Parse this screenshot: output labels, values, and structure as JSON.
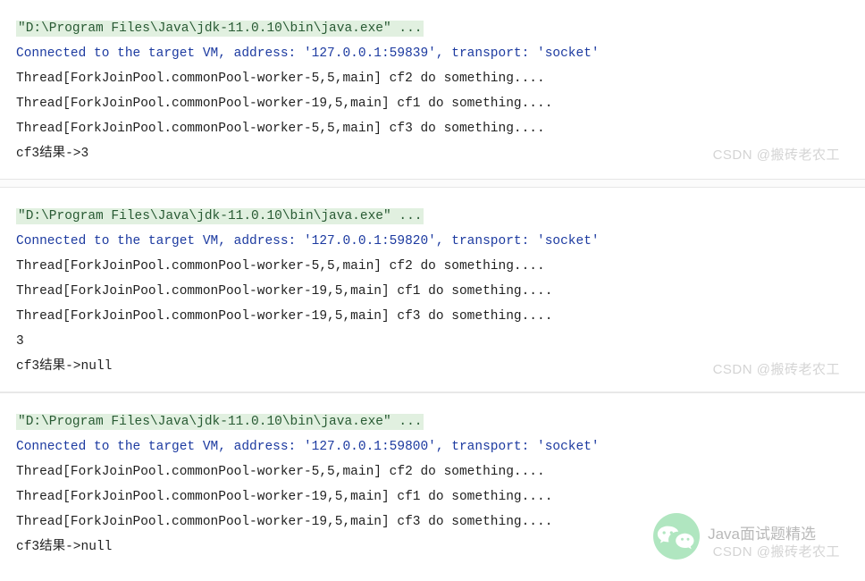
{
  "watermark_text": "CSDN @搬砖老农工",
  "wechat_label": "Java面试题精选",
  "blocks": [
    {
      "cmd": "\"D:\\Program Files\\Java\\jdk-11.0.10\\bin\\java.exe\" ...",
      "conn": "Connected to the target VM, address: '127.0.0.1:59839', transport: 'socket'",
      "lines": [
        "Thread[ForkJoinPool.commonPool-worker-5,5,main] cf2 do something....",
        "Thread[ForkJoinPool.commonPool-worker-19,5,main] cf1 do something....",
        "Thread[ForkJoinPool.commonPool-worker-5,5,main] cf3 do something....",
        "cf3结果->3"
      ]
    },
    {
      "cmd": "\"D:\\Program Files\\Java\\jdk-11.0.10\\bin\\java.exe\" ...",
      "conn": "Connected to the target VM, address: '127.0.0.1:59820', transport: 'socket'",
      "lines": [
        "Thread[ForkJoinPool.commonPool-worker-5,5,main] cf2 do something....",
        "Thread[ForkJoinPool.commonPool-worker-19,5,main] cf1 do something....",
        "Thread[ForkJoinPool.commonPool-worker-19,5,main] cf3 do something....",
        "3",
        "cf3结果->null"
      ]
    },
    {
      "cmd": "\"D:\\Program Files\\Java\\jdk-11.0.10\\bin\\java.exe\" ...",
      "conn": "Connected to the target VM, address: '127.0.0.1:59800', transport: 'socket'",
      "lines": [
        "Thread[ForkJoinPool.commonPool-worker-5,5,main] cf2 do something....",
        "Thread[ForkJoinPool.commonPool-worker-19,5,main] cf1 do something....",
        "Thread[ForkJoinPool.commonPool-worker-19,5,main] cf3 do something....",
        "cf3结果->null"
      ]
    }
  ]
}
